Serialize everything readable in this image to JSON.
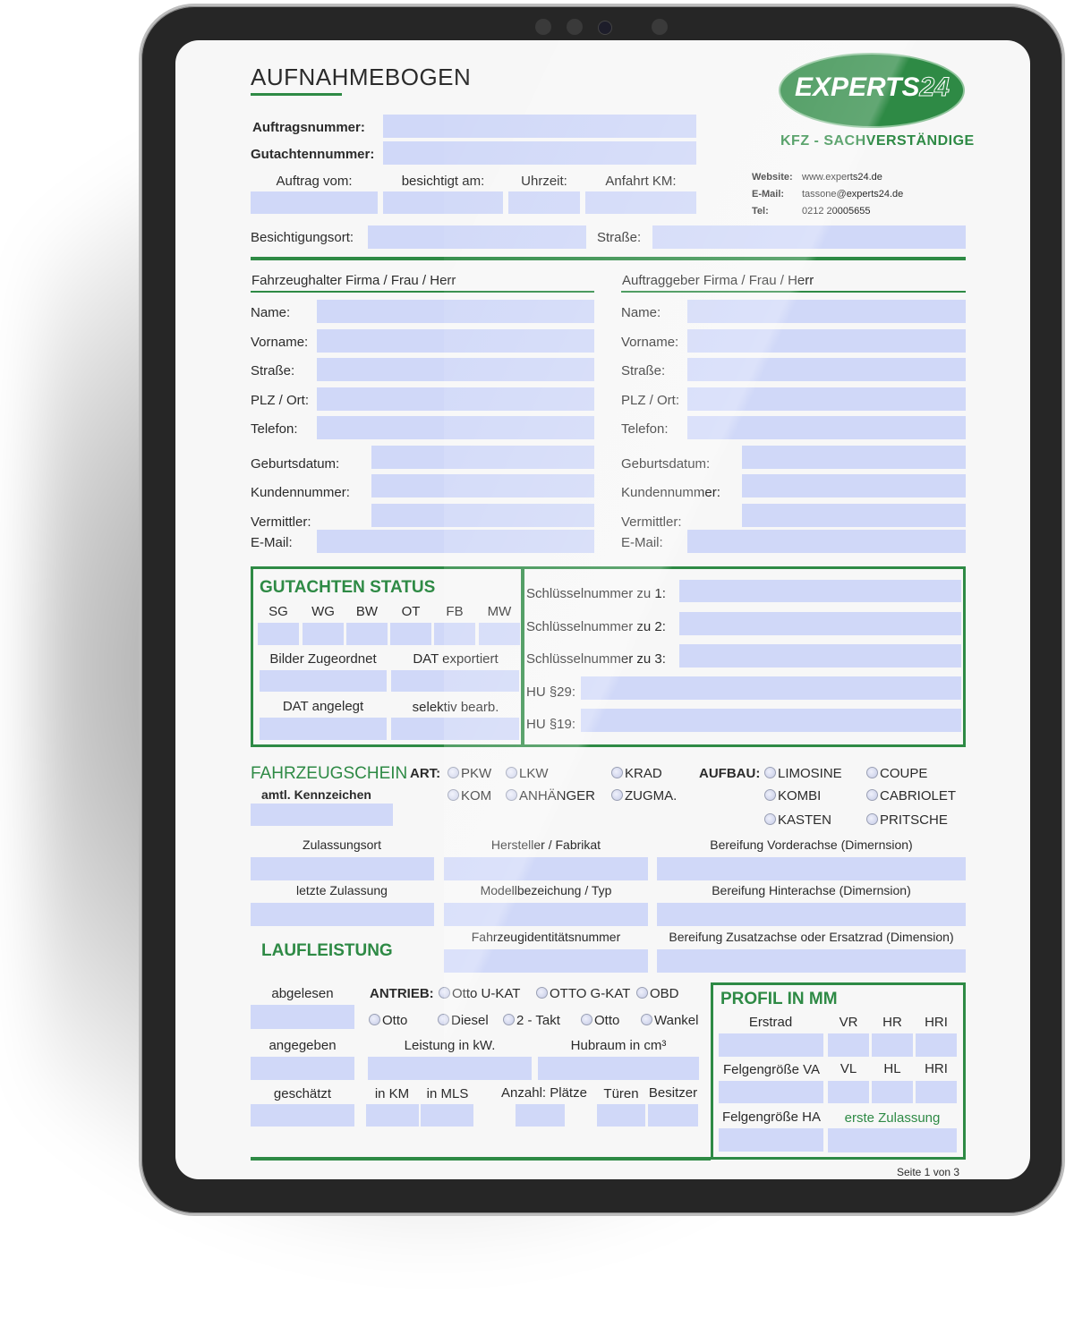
{
  "header": {
    "title": "AUFNAHMEBOGEN",
    "logo_text": "EXPERTS",
    "logo_number": "24",
    "tagline": "KFZ - SACHVERSTÄNDIGE",
    "contact": {
      "website_label": "Website:",
      "website": "www.experts24.de",
      "email_label": "E-Mail:",
      "email": "tassone@experts24.de",
      "tel_label": "Tel:",
      "tel": "0212 20005655"
    }
  },
  "order": {
    "auftragsnummer": {
      "label": "Auftragsnummer:",
      "value": ""
    },
    "gutachtennummer": {
      "label": "Gutachtennummer:",
      "value": ""
    },
    "auftrag_vom": {
      "label": "Auftrag vom:",
      "value": ""
    },
    "besichtigt_am": {
      "label": "besichtigt am:",
      "value": ""
    },
    "uhrzeit": {
      "label": "Uhrzeit:",
      "value": ""
    },
    "anfahrt_km": {
      "label": "Anfahrt KM:",
      "value": ""
    },
    "besichtigungsort": {
      "label": "Besichtigungsort:",
      "value": ""
    },
    "strasse": {
      "label": "Straße:",
      "value": ""
    }
  },
  "fahrzeughalter": {
    "heading": "Fahrzeughalter Firma / Frau / Herr",
    "fields": [
      {
        "label": "Name:",
        "value": ""
      },
      {
        "label": "Vorname:",
        "value": ""
      },
      {
        "label": "Straße:",
        "value": ""
      },
      {
        "label": "PLZ / Ort:",
        "value": ""
      },
      {
        "label": "Telefon:",
        "value": ""
      },
      {
        "label": "Geburtsdatum:",
        "value": ""
      },
      {
        "label": "Kundennummer:",
        "value": ""
      },
      {
        "label": "Vermittler:",
        "value": ""
      },
      {
        "label": "E-Mail:",
        "value": ""
      }
    ]
  },
  "auftraggeber": {
    "heading": "Auftraggeber Firma / Frau / Herr",
    "fields": [
      {
        "label": "Name:",
        "value": ""
      },
      {
        "label": "Vorname:",
        "value": ""
      },
      {
        "label": "Straße:",
        "value": ""
      },
      {
        "label": "PLZ / Ort:",
        "value": ""
      },
      {
        "label": "Telefon:",
        "value": ""
      },
      {
        "label": "Geburtsdatum:",
        "value": ""
      },
      {
        "label": "Kundennummer:",
        "value": ""
      },
      {
        "label": "Vermittler:",
        "value": ""
      },
      {
        "label": "E-Mail:",
        "value": ""
      }
    ]
  },
  "gutachten_status": {
    "heading": "GUTACHTEN STATUS",
    "columns": [
      "SG",
      "WG",
      "BW",
      "OT",
      "FB",
      "MW"
    ],
    "bilder_zugeordnet": "Bilder Zugeordnet",
    "dat_exportiert": "DAT exportiert",
    "dat_angelegt": "DAT angelegt",
    "selektiv_bearb": "selektiv bearb."
  },
  "schluessel": {
    "sn1": "Schlüsselnummer zu 1:",
    "sn2": "Schlüsselnummer zu 2:",
    "sn3": "Schlüsselnummer zu 3:",
    "hu29": "HU §29:",
    "hu19": "HU §19:"
  },
  "fahrzeugschein": {
    "heading": "FAHRZEUGSCHEIN",
    "kennzeichen_label": "amtl. Kennzeichen",
    "art_label": "ART:",
    "art_options": [
      "PKW",
      "LKW",
      "KRAD",
      "KOM",
      "ANHÄNGER",
      "ZUGMA."
    ],
    "aufbau_label": "AUFBAU:",
    "aufbau_options": [
      "LIMOSINE",
      "COUPE",
      "KOMBI",
      "CABRIOLET",
      "KASTEN",
      "PRITSCHE"
    ],
    "zulassungsort": "Zulassungsort",
    "hersteller": "Hersteller / Fabrikat",
    "bereifung_va": "Bereifung Vorderachse (Dimernsion)",
    "letzte_zulassung": "letzte Zulassung",
    "modell": "Modellbezeichung / Typ",
    "bereifung_ha": "Bereifung Hinterachse (Dimernsion)",
    "fin": "Fahrzeugidentitätsnummer",
    "bereifung_za": "Bereifung Zusatzachse oder Ersatzrad (Dimension)"
  },
  "laufleistung": {
    "heading": "LAUFLEISTUNG",
    "abgelesen": "abgelesen",
    "angegeben": "angegeben",
    "geschaetzt": "geschätzt",
    "antrieb_label": "ANTRIEB:",
    "antrieb_options": [
      "Otto U-KAT",
      "OTTO G-KAT",
      "OBD",
      "Otto",
      "Diesel",
      "2 - Takt",
      "Otto",
      "Wankel"
    ],
    "leistung": "Leistung in kW.",
    "hubraum": "Hubraum in cm³",
    "in_km": "in KM",
    "in_mls": "in MLS",
    "anzahl_plaetze": "Anzahl: Plätze",
    "tueren": "Türen",
    "besitzer": "Besitzer"
  },
  "profil": {
    "heading": "PROFIL IN MM",
    "erstrad": "Erstrad",
    "vr": "VR",
    "hr": "HR",
    "hri1": "HRI",
    "felgen_va": "Felgengröße VA",
    "vl": "VL",
    "hl": "HL",
    "hri2": "HRI",
    "felgen_ha": "Felgengröße HA",
    "erste_zulassung": "erste Zulassung"
  },
  "footer": {
    "page": "Seite 1 von 3"
  },
  "colors": {
    "accent": "#2e8a45",
    "field": "#d0d8f8",
    "text": "#2b2b2b"
  }
}
